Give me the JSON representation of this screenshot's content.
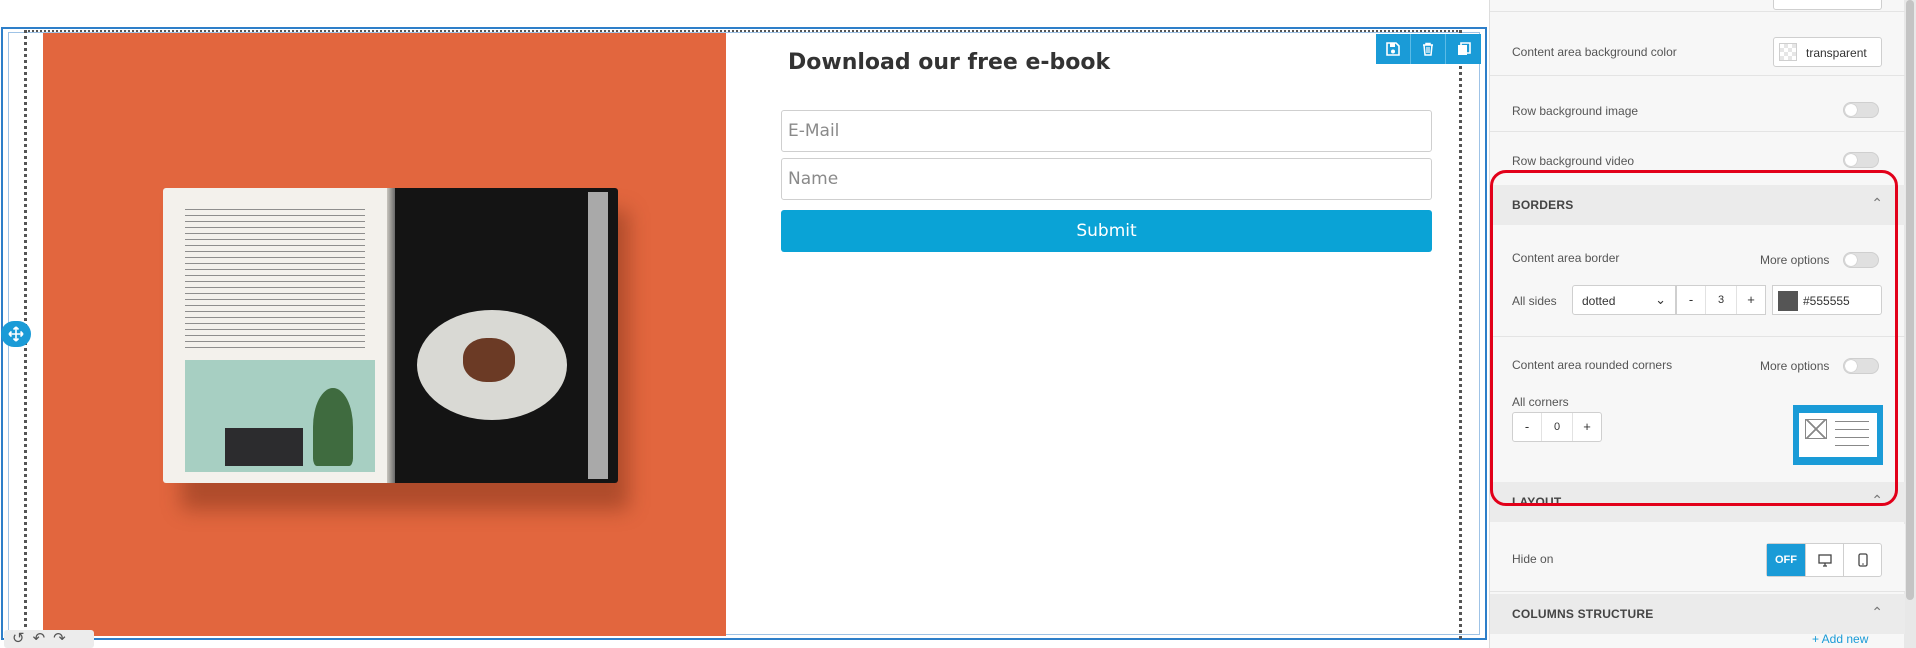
{
  "form": {
    "title": "Download our free e-book",
    "email_placeholder": "E-Mail",
    "name_placeholder": "Name",
    "submit_label": "Submit"
  },
  "row_tools": {
    "save_icon": "save-icon",
    "delete_icon": "trash-icon",
    "duplicate_icon": "duplicate-icon"
  },
  "history": {
    "history_icon": "history-icon",
    "undo_icon": "undo-icon",
    "redo_icon": "redo-icon"
  },
  "panel": {
    "content_bg_label": "Content area background color",
    "content_bg_value": "transparent",
    "row_bg_image_label": "Row background image",
    "row_bg_video_label": "Row background video",
    "borders_title": "BORDERS",
    "content_border_label": "Content area border",
    "more_options_1": "More options",
    "all_sides_label": "All sides",
    "border_style": "dotted",
    "border_width": "3",
    "border_color": "#555555",
    "rounded_label": "Content area rounded corners",
    "more_options_2": "More options",
    "all_corners_label": "All corners",
    "corner_radius": "0",
    "layout_title": "LAYOUT",
    "hide_on_label": "Hide on",
    "hide_off": "OFF",
    "columns_title": "COLUMNS STRUCTURE",
    "add_new": "+ Add new",
    "minus": "-",
    "plus": "+"
  },
  "colors": {
    "accent": "#1a9bd7",
    "submit": "#0aa3d6",
    "hero_bg": "#e2663e",
    "highlight": "#e2001a"
  }
}
